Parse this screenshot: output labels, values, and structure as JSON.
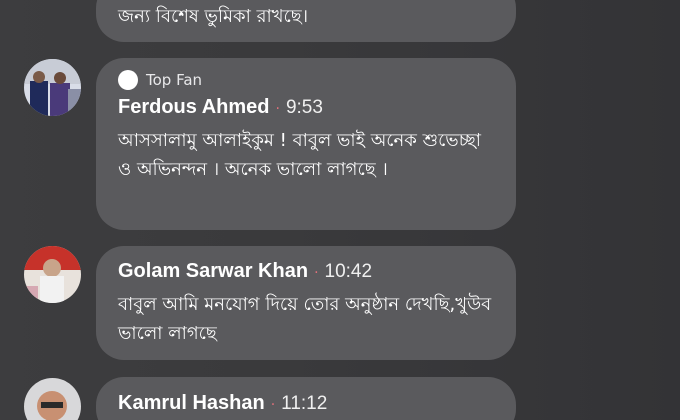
{
  "comments": [
    {
      "text": "জন্য বিশেষ ভুমিকা রাখছে।"
    },
    {
      "badge": "Top Fan",
      "author": "Ferdous Ahmed",
      "separator": "·",
      "time": "9:53",
      "text": "আসসালামু আলাইকুম ! বাবুল ভাই অনেক শুভেচ্ছা ও অভিনন্দন । অনেক ভালো লাগছে ।"
    },
    {
      "author": "Golam Sarwar Khan",
      "separator": "·",
      "time": "10:42",
      "text": "বাবুল আমি মনযোগ দিয়ে তোর অনুষ্ঠান দেখছি,খুউব ভালো লাগছে"
    },
    {
      "author": "Kamrul Hashan",
      "separator": "·",
      "time": "11:12"
    }
  ],
  "colors": {
    "background": "#3a3a3c",
    "bubble": "#5a5a5d",
    "separator_dot": "#e0707a"
  }
}
